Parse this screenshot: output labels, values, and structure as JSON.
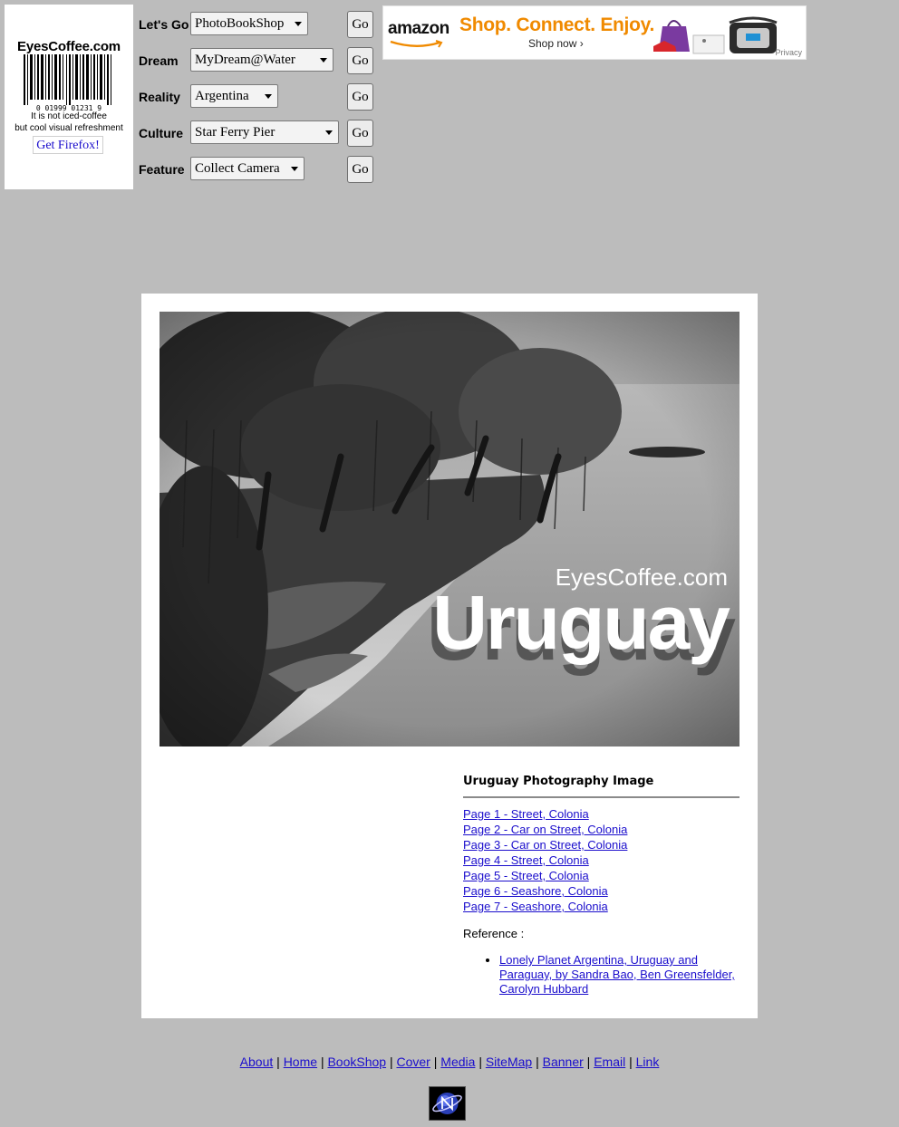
{
  "logo": {
    "site_name": "EyesCoffee.com",
    "barcode_digits": "0  01999 01231  9",
    "tagline_1": "It is not iced-coffee",
    "tagline_2": "but cool visual refreshment",
    "firefox_label": "Get Firefox!"
  },
  "nav": {
    "go_label": "Go",
    "rows": [
      {
        "label": "Let's Go",
        "selected": "PhotoBookShop"
      },
      {
        "label": "Dream",
        "selected": "MyDream@Water"
      },
      {
        "label": "Reality",
        "selected": "Argentina"
      },
      {
        "label": "Culture",
        "selected": "Star Ferry Pier"
      },
      {
        "label": "Feature",
        "selected": "Collect Camera"
      }
    ]
  },
  "ad": {
    "brand": "amazon",
    "slogan": "Shop. Connect. Enjoy.",
    "cta": "Shop now ›",
    "privacy": "Privacy"
  },
  "photo": {
    "watermark_site": "EyesCoffee.com",
    "watermark_title": "Uruguay"
  },
  "sidebar": {
    "title": "Uruguay Photography Image",
    "pages": [
      "Page 1 - Street, Colonia",
      "Page 2 - Car on Street, Colonia",
      "Page 3 - Car on Street, Colonia",
      "Page 4 - Street, Colonia",
      "Page 5 - Street, Colonia",
      "Page 6 - Seashore, Colonia",
      "Page 7 - Seashore, Colonia"
    ],
    "reference_label": "Reference :",
    "references": [
      "Lonely Planet Argentina, Uruguay and Paraguay, by Sandra Bao, Ben Greensfelder, Carolyn Hubbard"
    ]
  },
  "footer": {
    "links": [
      "About",
      "Home",
      "BookShop",
      "Cover",
      "Media",
      "SiteMap",
      "Banner",
      "Email",
      "Link"
    ],
    "separator": "|"
  },
  "colors": {
    "page_bg": "#bcbcbc",
    "link": "#1a0dcc",
    "ad_orange": "#f08a00"
  }
}
